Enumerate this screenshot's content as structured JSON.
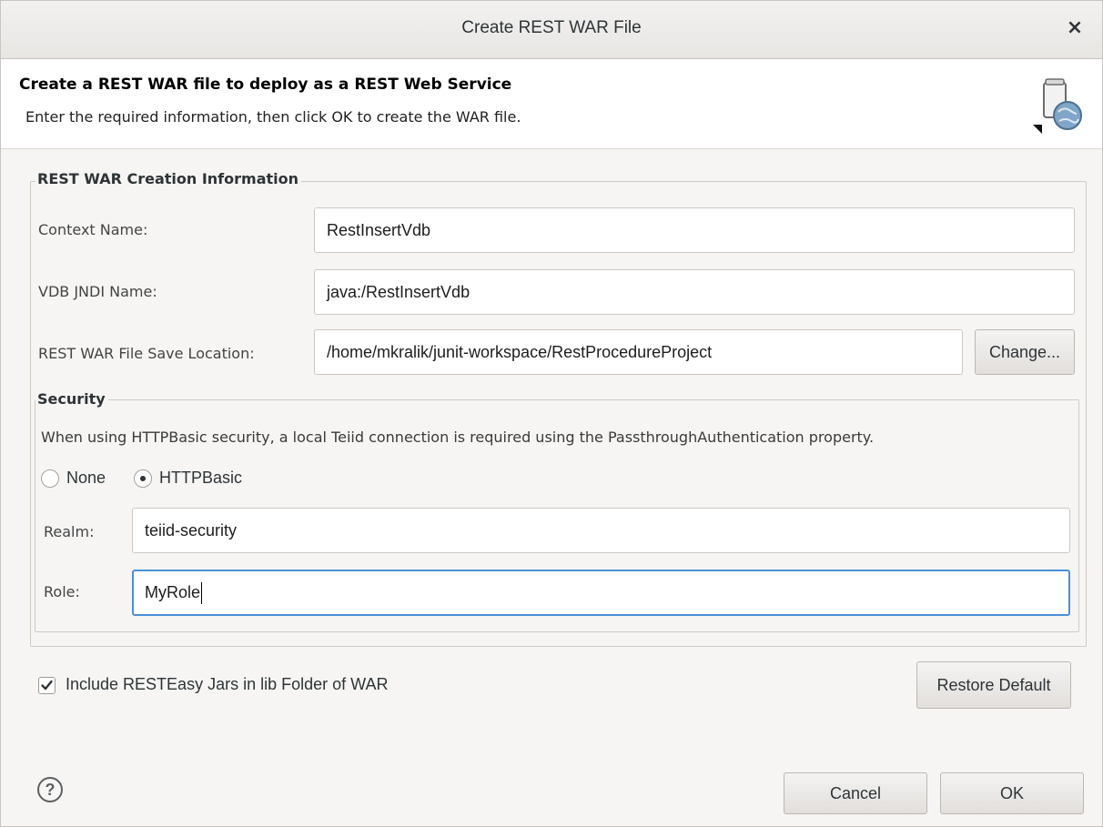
{
  "window": {
    "title": "Create REST WAR File",
    "close_glyph": "×"
  },
  "header": {
    "title": "Create a REST WAR file to deploy as a REST Web Service",
    "subtitle": "Enter the required information, then click OK to create the WAR file.",
    "icon": "war-file-globe-icon"
  },
  "info_group": {
    "label": "REST WAR Creation Information",
    "context_name": {
      "label": "Context Name:",
      "value": "RestInsertVdb"
    },
    "vdb_jndi_name": {
      "label": "VDB JNDI Name:",
      "value": "java:/RestInsertVdb"
    },
    "save_location": {
      "label": "REST WAR File Save Location:",
      "value": "/home/mkralik/junit-workspace/RestProcedureProject",
      "change_button": "Change..."
    }
  },
  "security_group": {
    "label": "Security",
    "note": "When using HTTPBasic security, a local Teiid connection is required using the PassthroughAuthentication property.",
    "options": [
      "None",
      "HTTPBasic"
    ],
    "selected": "HTTPBasic",
    "realm": {
      "label": "Realm:",
      "value": "teiid-security"
    },
    "role": {
      "label": "Role:",
      "value": "MyRole"
    }
  },
  "include_jars": {
    "label": "Include RESTEasy Jars in lib Folder of WAR",
    "checked": true
  },
  "restore_default_button": "Restore Default",
  "footer": {
    "help_glyph": "?",
    "cancel_button": "Cancel",
    "ok_button": "OK"
  },
  "colors": {
    "focus": "#4a90d9",
    "dialog_bg": "#f6f5f4"
  }
}
